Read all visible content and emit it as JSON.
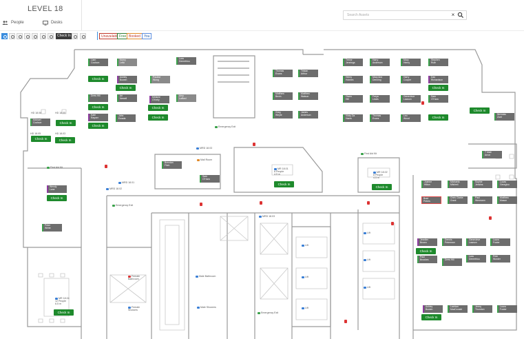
{
  "header": {
    "title": "LEVEL 18",
    "tabs": [
      {
        "label": "People",
        "icon": "people-icon"
      },
      {
        "label": "Desks",
        "icon": "monitor-icon"
      }
    ],
    "search": {
      "placeholder": "Search Assets",
      "clear": "×"
    }
  },
  "toolbar": {
    "icons": [
      "pencil-icon",
      "target-icon",
      "zoom-in-icon",
      "zoom-out-icon",
      "fit-icon",
      "print-icon",
      "trash-icon",
      "link-icon",
      "gear-icon"
    ],
    "checkin_label": "Check In",
    "legend": {
      "available": "Unavailable",
      "free": "Free",
      "booked": "Booked",
      "you": "You"
    }
  },
  "desks": [
    {
      "id": "d1",
      "line1": "Liam",
      "line2": "Coulson"
    },
    {
      "id": "d2",
      "line1": "Nomy",
      "line2": "Lello"
    },
    {
      "id": "d3",
      "line1": "Lara",
      "line2": "Demetriou"
    },
    {
      "id": "d4",
      "line1": "Ashley",
      "line2": "Bowen"
    },
    {
      "id": "d5",
      "line1": "Pauline",
      "line2": "Wong"
    },
    {
      "id": "d6",
      "line1": "Drew Hill",
      "line2": ""
    },
    {
      "id": "d7",
      "line1": "Ari",
      "line2": "Newell"
    },
    {
      "id": "d8",
      "line1": "Melanie",
      "line2": "O'Kelly"
    },
    {
      "id": "d9",
      "line1": "Amy",
      "line2": "Lafford"
    },
    {
      "id": "d10",
      "line1": "Kate",
      "line2": "Rayner"
    },
    {
      "id": "d11",
      "line1": "John",
      "line2": "Ewada"
    },
    {
      "id": "d12",
      "line1": "Michael",
      "line2": "Coulson"
    },
    {
      "id": "d13",
      "line1": "Thomas",
      "line2": "Evans"
    },
    {
      "id": "d14",
      "line1": "Tristan",
      "line2": "Arthur"
    },
    {
      "id": "d15",
      "line1": "Matthew",
      "line2": "Bevin"
    },
    {
      "id": "d16",
      "line1": "Matthew",
      "line2": "Watson"
    },
    {
      "id": "d17",
      "line1": "Greg",
      "line2": "Whyte"
    },
    {
      "id": "d18",
      "line1": "James",
      "line2": "Anderson"
    },
    {
      "id": "d19",
      "line1": "Trevor",
      "line2": "Jennings"
    },
    {
      "id": "d20",
      "line1": "Harry",
      "line2": "Anderson"
    },
    {
      "id": "d21",
      "line1": "Mary",
      "line2": "Henry"
    },
    {
      "id": "d22",
      "line1": "Stephen",
      "line2": "Rule"
    },
    {
      "id": "d23",
      "line1": "Henry",
      "line2": "Holmes"
    },
    {
      "id": "d24",
      "line1": "Mary Ann",
      "line2": "Denning"
    },
    {
      "id": "d25",
      "line1": "Harry",
      "line2": "Cooper"
    },
    {
      "id": "d26",
      "line1": "Dan",
      "line2": "Richardson"
    },
    {
      "id": "d27",
      "line1": "Owen",
      "line2": "Hill"
    },
    {
      "id": "d28",
      "line1": "Freya",
      "line2": "Lewis"
    },
    {
      "id": "d29",
      "line1": "Genevieve",
      "line2": "Lawson"
    },
    {
      "id": "d30",
      "line1": "Sam",
      "line2": "O'Hara"
    },
    {
      "id": "d31",
      "line1": "Vicky Da",
      "line2": "Hants"
    },
    {
      "id": "d32",
      "line1": "Thomas",
      "line2": "Evans"
    },
    {
      "id": "d33",
      "line1": "Leo",
      "line2": "Wood"
    },
    {
      "id": "d34",
      "line1": "Nicholas",
      "line2": "Zoet"
    },
    {
      "id": "d35",
      "line1": "Brendan",
      "line2": "Fitch"
    },
    {
      "id": "d36",
      "line1": "Sam",
      "line2": "O'Hara"
    },
    {
      "id": "d37",
      "line1": "Wendy",
      "line2": "Lane"
    },
    {
      "id": "d38",
      "line1": "Peter",
      "line2": "White"
    },
    {
      "id": "d39",
      "line1": "T Matt",
      "line2": "Arron"
    },
    {
      "id": "d40",
      "line1": "Joanne",
      "line2": "Hilton"
    },
    {
      "id": "d41",
      "line1": "Michaela",
      "line2": "Mitchell"
    },
    {
      "id": "d42",
      "line1": "Sophie",
      "line2": "Jenkins"
    },
    {
      "id": "d43",
      "line1": "Lucas",
      "line2": "Georgiou"
    },
    {
      "id": "d44",
      "line1": "Brad",
      "line2": "Peters"
    },
    {
      "id": "d45",
      "line1": "Chris Clarke",
      "line2": "Grant"
    },
    {
      "id": "d46",
      "line1": "Paul",
      "line2": "Wermann"
    },
    {
      "id": "d47",
      "line1": "Matthew",
      "line2": "Mason"
    },
    {
      "id": "d48",
      "line1": "Jennifer",
      "line2": "Brown"
    },
    {
      "id": "d49",
      "line1": "Dennis",
      "line2": "Peterman"
    },
    {
      "id": "d50",
      "line1": "Genevieve",
      "line2": "Lawson"
    },
    {
      "id": "d51",
      "line1": "Laura",
      "line2": "Foster"
    },
    {
      "id": "d52",
      "line1": "Paul",
      "line2": "Brookes"
    },
    {
      "id": "d53",
      "line1": "Drew Hill",
      "line2": ""
    },
    {
      "id": "d54",
      "line1": "Lara",
      "line2": "Demetriou"
    },
    {
      "id": "d55",
      "line1": "Pete",
      "line2": "Worder"
    },
    {
      "id": "d56",
      "line1": "Ashley",
      "line2": "Bowen"
    },
    {
      "id": "d57",
      "line1": "Lachlan",
      "line2": "MacDonald"
    },
    {
      "id": "d58",
      "line1": "Jenny",
      "line2": "Thornton"
    },
    {
      "id": "d59",
      "line1": "Laura",
      "line2": "Foster"
    }
  ],
  "checkin_label": "Check In",
  "labels": {
    "desk_hd_1": "HD 18.08",
    "desk_hd_2": "HD 18.05",
    "desk_hd_3": "HD 18.03",
    "emergency_exit": "Emergency Exit",
    "emergency_exit_2": "Emergency Exit",
    "emergency_exit_3": "Emergency Exit",
    "first_aid": "First Aid Kit",
    "first_aid_2": "First Aid Kit",
    "mrd_1": "MRD 18.03",
    "mrd_2": "MRD 18.01",
    "mrd_3": "MRD 18.02",
    "mail_room": "Mail Room",
    "mr_1801": "MR 18.01",
    "mr_1801_cap": "8 People",
    "mr_1801_size": "4.5 m",
    "mr_1802": "MR 18.02",
    "mr_1802_cap": "8 People",
    "mr_1802_size": "4.5 m",
    "mr_1804": "MR 18.04",
    "mr_1804_cap": "12 People",
    "mr_1804_size": "6.5 m",
    "female_bathroom": "Female Bathroom",
    "male_bathroom": "Male Bathroom",
    "female_showers": "Female Showers",
    "male_showers": "Male Showers",
    "lift": "Lift"
  }
}
